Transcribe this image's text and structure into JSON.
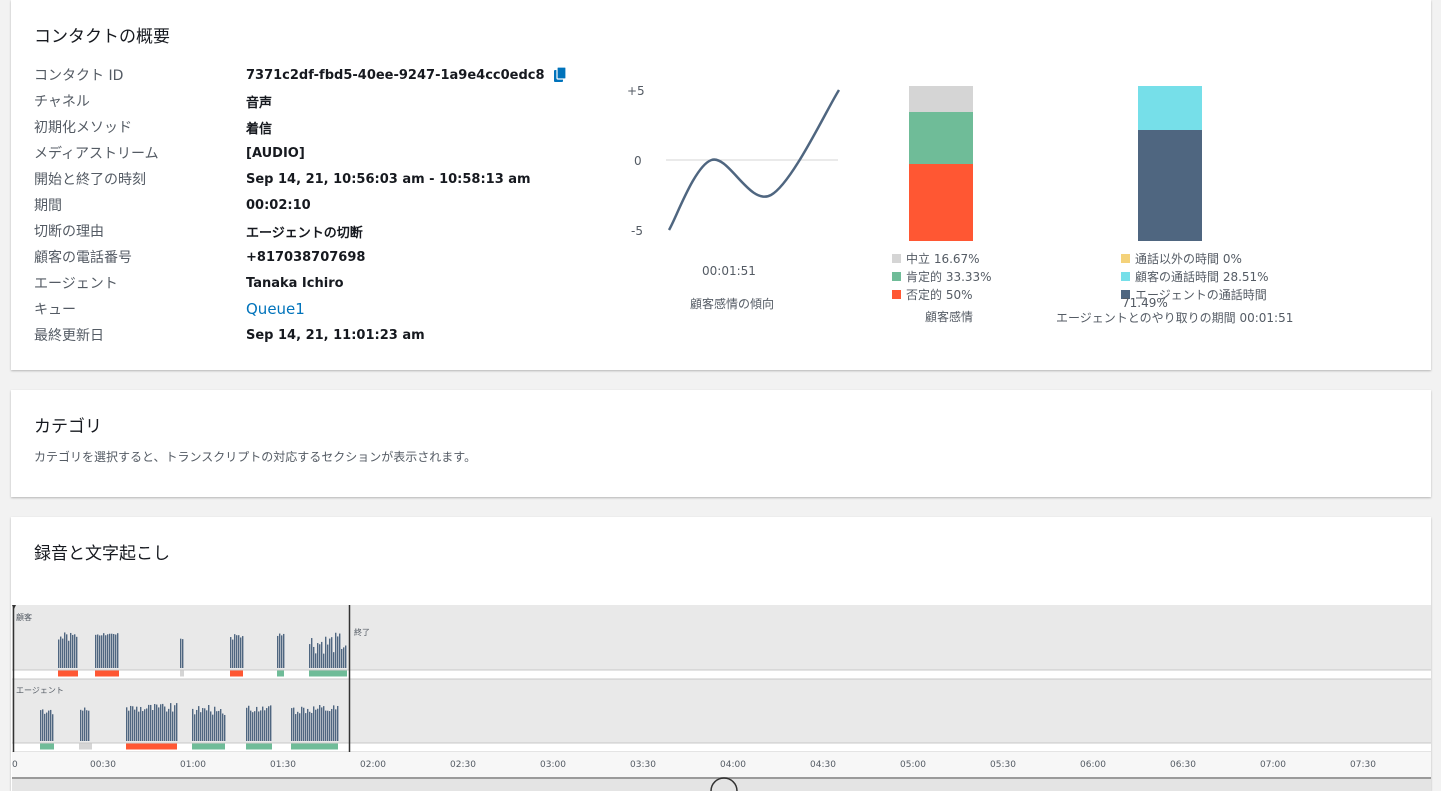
{
  "summary": {
    "title": "コンタクトの概要",
    "rows": [
      {
        "label": "コンタクト ID",
        "value": "7371c2df-fbd5-40ee-9247-1a9e4cc0edc8"
      },
      {
        "label": "チャネル",
        "value": "音声"
      },
      {
        "label": "初期化メソッド",
        "value": "着信"
      },
      {
        "label": "メディアストリーム",
        "value": "[AUDIO]"
      },
      {
        "label": "開始と終了の時刻",
        "value": "Sep 14, 21, 10:56:03 am - 10:58:13 am"
      },
      {
        "label": "期間",
        "value": "00:02:10"
      },
      {
        "label": "切断の理由",
        "value": "エージェントの切断"
      },
      {
        "label": "顧客の電話番号",
        "value": "+817038707698"
      },
      {
        "label": "エージェント",
        "value": "Tanaka Ichiro"
      },
      {
        "label": "キュー",
        "value": "Queue1"
      },
      {
        "label": "最終更新日",
        "value": "Sep 14, 21, 11:01:23 am"
      }
    ],
    "copy_icon": "copy-icon"
  },
  "charts": {
    "trend": {
      "yticks": [
        "+5",
        "0",
        "-5"
      ],
      "time_label": "00:01:51",
      "caption": "顧客感情の傾向"
    },
    "sentiment": {
      "legend": [
        "中立 16.67%",
        "肯定的 33.33%",
        "否定的 50%"
      ],
      "caption": "顧客感情"
    },
    "talktime": {
      "legend": [
        "通話以外の時間 0%",
        "顧客の通話時間 28.51%",
        "エージェントの通話時間",
        "71.49%"
      ],
      "caption": "エージェントとのやり取りの期間 00:01:51"
    }
  },
  "chart_data": [
    {
      "type": "line",
      "ylim": [
        -5,
        5
      ],
      "y_tick_labels": [
        "+5",
        "0",
        "-5"
      ],
      "points": [
        [
          0,
          -5
        ],
        [
          0.25,
          0
        ],
        [
          0.6,
          -2.5
        ],
        [
          1.0,
          5
        ]
      ]
    },
    {
      "type": "bar",
      "stacked": true,
      "series": [
        {
          "name": "否定的",
          "value": 50,
          "color": "#ff5733"
        },
        {
          "name": "肯定的",
          "value": 33.33,
          "color": "#6fbc98"
        },
        {
          "name": "中立",
          "value": 16.67,
          "color": "#d5d5d5"
        }
      ]
    },
    {
      "type": "bar",
      "stacked": true,
      "series": [
        {
          "name": "エージェントの通話時間",
          "value": 71.49,
          "color": "#4f6680"
        },
        {
          "name": "顧客の通話時間",
          "value": 28.51,
          "color": "#76dfe9"
        },
        {
          "name": "通話以外の時間",
          "value": 0,
          "color": "#f4d27a"
        }
      ]
    }
  ],
  "colors": {
    "neutral": "#d5d5d5",
    "positive": "#6fbc98",
    "negative": "#ff5733",
    "nontalk": "#f4d27a",
    "customer_talk": "#76dfe9",
    "agent_talk": "#4f6680",
    "link": "#0073bb"
  },
  "categories": {
    "title": "カテゴリ",
    "description": "カテゴリを選択すると、トランスクリプトの対応するセクションが表示されます。"
  },
  "recording": {
    "title": "録音と文字起こし",
    "customer_label": "顧客",
    "agent_label": "エージェント",
    "end_label": "終了",
    "time_ticks": [
      "0",
      "00:30",
      "01:00",
      "01:30",
      "02:00",
      "02:30",
      "03:00",
      "03:30",
      "04:00",
      "04:30",
      "05:00",
      "05:30",
      "06:00",
      "06:30",
      "07:00",
      "07:30"
    ]
  }
}
